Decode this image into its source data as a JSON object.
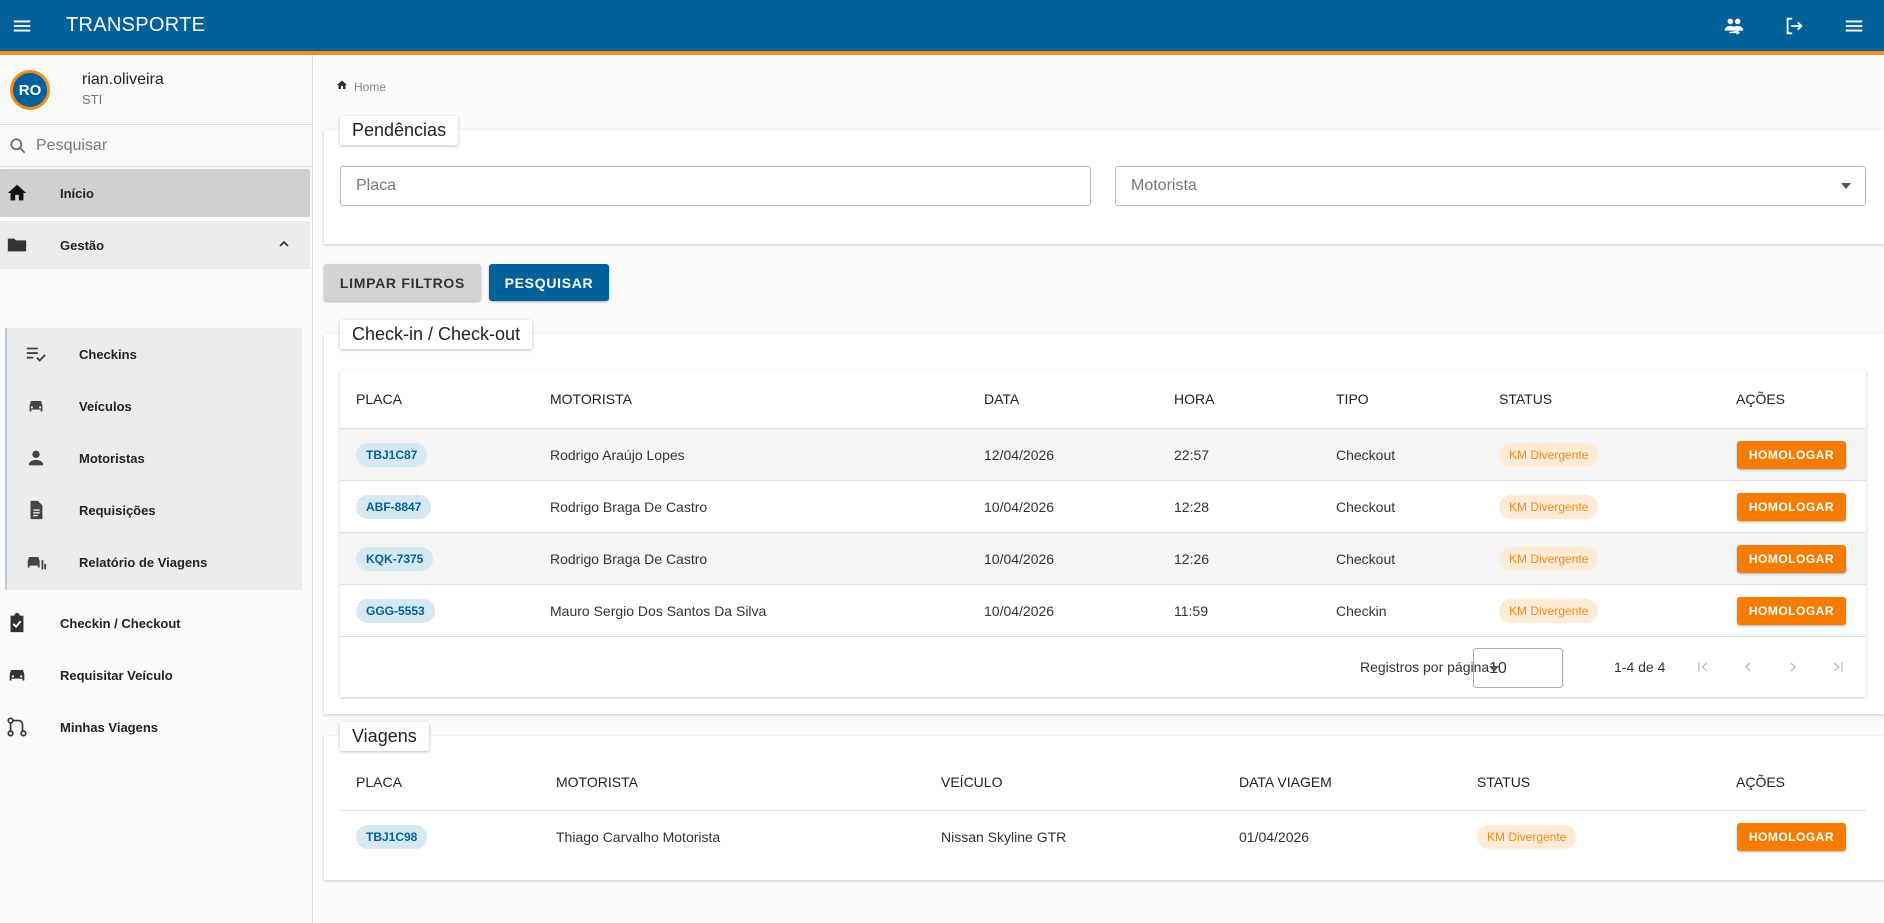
{
  "app": {
    "title": "TRANSPORTE"
  },
  "user": {
    "initials": "RO",
    "name": "rian.oliveira",
    "department": "STI"
  },
  "search": {
    "placeholder": "Pesquisar"
  },
  "sidebar": {
    "items": [
      {
        "label": "Início",
        "icon": "home-icon"
      },
      {
        "label": "Gestão",
        "icon": "folder-icon"
      },
      {
        "label": "Checkin / Checkout",
        "icon": "clipboard-check-icon"
      },
      {
        "label": "Requisitar Veículo",
        "icon": "car-icon"
      },
      {
        "label": "Minhas Viagens",
        "icon": "route-icon"
      }
    ],
    "subitems": [
      {
        "label": "Checkins",
        "icon": "checklist-icon"
      },
      {
        "label": "Veículos",
        "icon": "car-icon"
      },
      {
        "label": "Motoristas",
        "icon": "person-icon"
      },
      {
        "label": "Requisições",
        "icon": "document-icon"
      },
      {
        "label": "Relatório de Viagens",
        "icon": "car-report-icon"
      }
    ]
  },
  "breadcrumb": {
    "home": "Home"
  },
  "pendencias": {
    "title": "Pendências",
    "placa_placeholder": "Placa",
    "motorista_placeholder": "Motorista",
    "clear_label": "LIMPAR FILTROS",
    "search_label": "PESQUISAR"
  },
  "checkin": {
    "title": "Check-in / Check-out",
    "headers": [
      "PLACA",
      "MOTORISTA",
      "DATA",
      "HORA",
      "TIPO",
      "STATUS",
      "AÇÕES"
    ],
    "rows": [
      {
        "placa": "TBJ1C87",
        "motorista": "Rodrigo Araújo Lopes",
        "data": "12/04/2026",
        "hora": "22:57",
        "tipo": "Checkout",
        "status": "KM Divergente",
        "acao": "HOMOLOGAR"
      },
      {
        "placa": "ABF-8847",
        "motorista": "Rodrigo Braga De Castro",
        "data": "10/04/2026",
        "hora": "12:28",
        "tipo": "Checkout",
        "status": "KM Divergente",
        "acao": "HOMOLOGAR"
      },
      {
        "placa": "KQK-7375",
        "motorista": "Rodrigo Braga De Castro",
        "data": "10/04/2026",
        "hora": "12:26",
        "tipo": "Checkout",
        "status": "KM Divergente",
        "acao": "HOMOLOGAR"
      },
      {
        "placa": "GGG-5553",
        "motorista": "Mauro Sergio Dos Santos Da Silva",
        "data": "10/04/2026",
        "hora": "11:59",
        "tipo": "Checkin",
        "status": "KM Divergente",
        "acao": "HOMOLOGAR"
      }
    ],
    "pager": {
      "label": "Registros por página",
      "per_page": "10",
      "range": "1-4 de 4"
    }
  },
  "viagens": {
    "title": "Viagens",
    "headers": [
      "PLACA",
      "MOTORISTA",
      "VEÍCULO",
      "DATA VIAGEM",
      "STATUS",
      "AÇÕES"
    ],
    "rows": [
      {
        "placa": "TBJ1C98",
        "motorista": "Thiago Carvalho Motorista",
        "veiculo": "Nissan Skyline GTR",
        "data": "01/04/2026",
        "status": "KM Divergente",
        "acao": "HOMOLOGAR"
      }
    ]
  },
  "colors": {
    "primary": "#03619a",
    "accent": "#f68a1f",
    "action": "#f57c00"
  }
}
